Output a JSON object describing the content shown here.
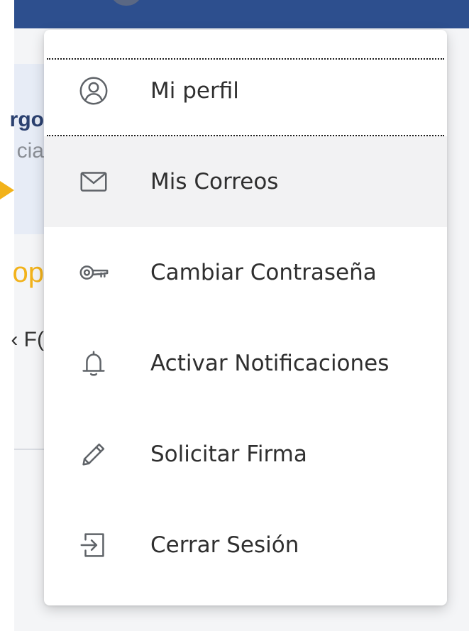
{
  "background": {
    "peek_texts": [
      "rgo",
      "cia",
      "op",
      "‹ F("
    ]
  },
  "menu": {
    "items": [
      {
        "label": "Mi perfil",
        "icon": "user-circle-icon"
      },
      {
        "label": "Mis Correos",
        "icon": "envelope-icon",
        "active": true
      },
      {
        "label": "Cambiar Contraseña",
        "icon": "key-icon"
      },
      {
        "label": "Activar Notificaciones",
        "icon": "bell-icon"
      },
      {
        "label": "Solicitar Firma",
        "icon": "pencil-icon"
      },
      {
        "label": "Cerrar Sesión",
        "icon": "sign-out-icon"
      }
    ]
  },
  "colors": {
    "topbar": "#2d4f8e",
    "accent": "#f2b21a",
    "icon": "#5f6368",
    "text": "#2f2f2f",
    "active_bg": "#f2f2f3"
  }
}
